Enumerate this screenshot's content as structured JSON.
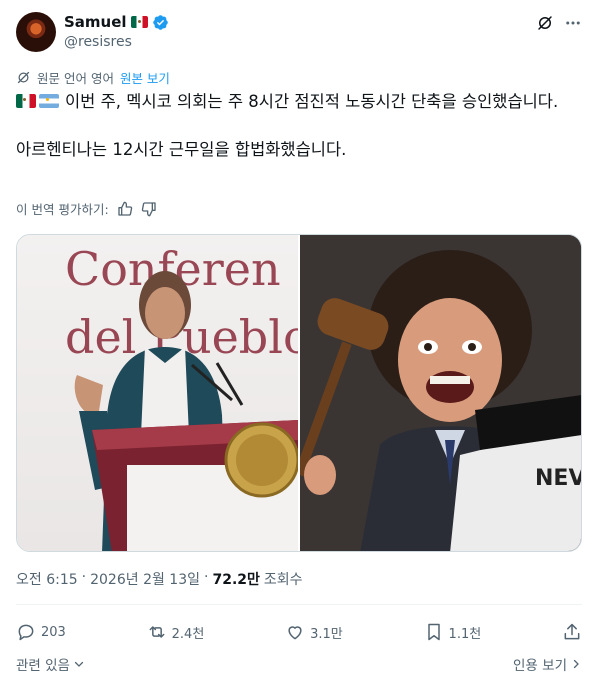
{
  "author": {
    "display_name": "Samuel",
    "handle": "@resisres",
    "name_flag_icon": "mexico-flag-icon",
    "verified_icon": "verified-badge-icon",
    "verified_color": "#1d9bf0"
  },
  "header_icons": [
    "grok-icon",
    "more-icon"
  ],
  "translation": {
    "note": "원문 언어 영어",
    "show_original": "원본 보기"
  },
  "tweet": {
    "flags": [
      "mexico-flag-icon",
      "argentina-flag-icon"
    ],
    "line1": "이번 주, 멕시코 의회는 주 8시간 점진적 노동시간 단축을 승인했습니다.",
    "line2": "아르헨티나는 12시간 근무일을 합법화했습니다."
  },
  "rate_translation": {
    "label": "이 번역 평가하기:",
    "icons": [
      "thumbs-up-icon",
      "thumbs-down-icon"
    ]
  },
  "media": {
    "left_caption_text": "Conferencia del Pueblo",
    "right_sign_text": "NEV"
  },
  "meta": {
    "time": "오전 6:15",
    "sep1": "·",
    "date": "2026년 2월 13일",
    "sep2": "·",
    "views_count": "72.2만",
    "views_label": "조회수"
  },
  "actions": {
    "replies": "203",
    "reposts": "2.4천",
    "likes": "3.1만",
    "bookmarks": "1.1천"
  },
  "footer": {
    "related": "관련 있음",
    "quotes": "인용 보기"
  },
  "colors": {
    "text_primary": "#0f1419",
    "text_secondary": "#536471",
    "accent": "#1d9bf0",
    "border": "#cfd9de"
  }
}
